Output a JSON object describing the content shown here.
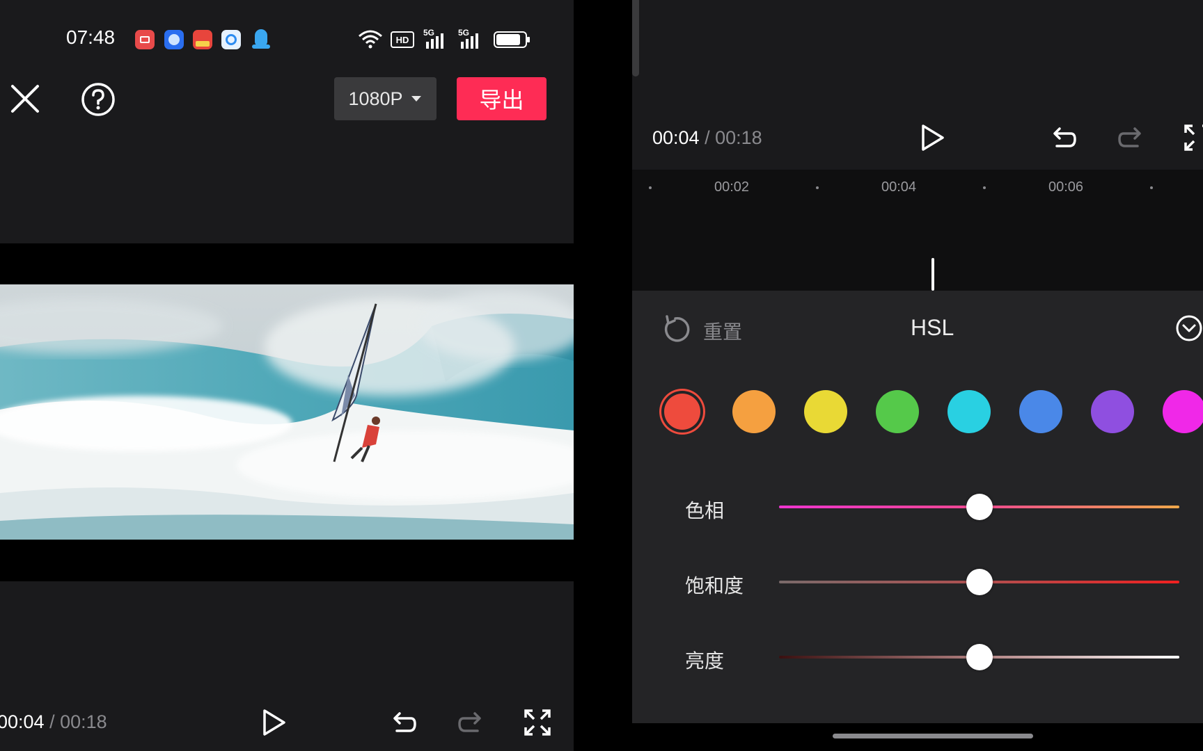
{
  "status_bar": {
    "time": "07:48",
    "app_icons": [
      "screen-recorder-icon",
      "browser-icon",
      "toutiao-icon",
      "qq-browser-icon",
      "qq-icon"
    ],
    "indicators": [
      "wifi-icon",
      "hd-icon",
      "5g-signal-icon",
      "5g-signal-icon",
      "battery-icon"
    ],
    "hd_label": "HD",
    "network_label": "5G"
  },
  "left_toolbar": {
    "resolution": "1080P",
    "export_label": "导出"
  },
  "left_player": {
    "current": "00:04",
    "separator": "/",
    "total": "00:18"
  },
  "right_player": {
    "current": "00:04",
    "separator": "/",
    "total": "00:18"
  },
  "timeline": {
    "ticks": [
      "00:02",
      "00:04",
      "00:06"
    ]
  },
  "hsl_panel": {
    "reset_label": "重置",
    "title": "HSL",
    "swatches": [
      {
        "name": "red",
        "color": "#ee4b3d",
        "selected": true
      },
      {
        "name": "orange",
        "color": "#f5a040"
      },
      {
        "name": "yellow",
        "color": "#e9d935"
      },
      {
        "name": "green",
        "color": "#55c94a"
      },
      {
        "name": "cyan",
        "color": "#29d0e2"
      },
      {
        "name": "blue",
        "color": "#4a88e8"
      },
      {
        "name": "purple",
        "color": "#8f4fe0"
      },
      {
        "name": "magenta",
        "color": "#f028e8"
      }
    ],
    "sliders": [
      {
        "label": "色相",
        "value": 0.5
      },
      {
        "label": "饱和度",
        "value": 0.5
      },
      {
        "label": "亮度",
        "value": 0.5
      }
    ]
  },
  "colors": {
    "accent": "#fe2c55",
    "panel_bg": "#242426",
    "toolbar_bg": "#1a1a1c"
  }
}
